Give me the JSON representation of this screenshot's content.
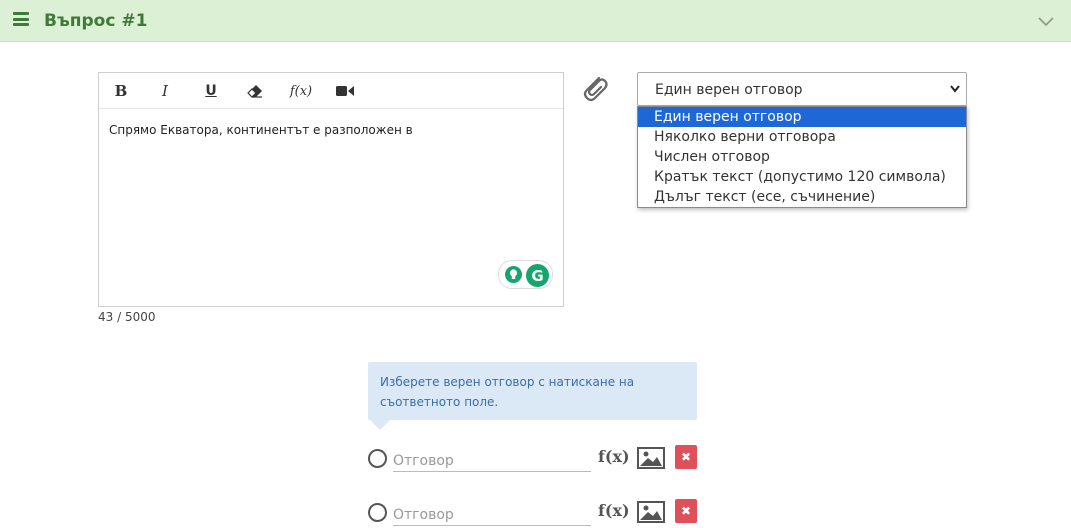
{
  "header": {
    "title": "Въпрос #1"
  },
  "editor": {
    "text": "Спрямо Екватора, континентът е разположен в",
    "counter": "43 / 5000",
    "toolbar": {
      "bold": "B",
      "italic": "I",
      "underline": "U",
      "formula": "f(x)"
    },
    "grammarly_letter": "G"
  },
  "question_type": {
    "selected": "Един верен отговор",
    "options": [
      "Един верен отговор",
      "Няколко верни отговора",
      "Числен отговор",
      "Кратък текст (допустимо 120 символа)",
      "Дълъг текст (есе, съчинение)"
    ]
  },
  "hint": {
    "text": "Изберете верен отговор с натискане на съответното поле."
  },
  "answers": [
    {
      "placeholder": "Отговор",
      "formula": "f(x)",
      "delete": "✖"
    },
    {
      "placeholder": "Отговор",
      "formula": "f(x)",
      "delete": "✖"
    }
  ],
  "colors": {
    "header_bg": "#dcf0d6",
    "header_text": "#3f7a36",
    "selected_option": "#1d68d6",
    "hint_bg": "#dbe8f6",
    "delete_bg": "#e0505a"
  }
}
